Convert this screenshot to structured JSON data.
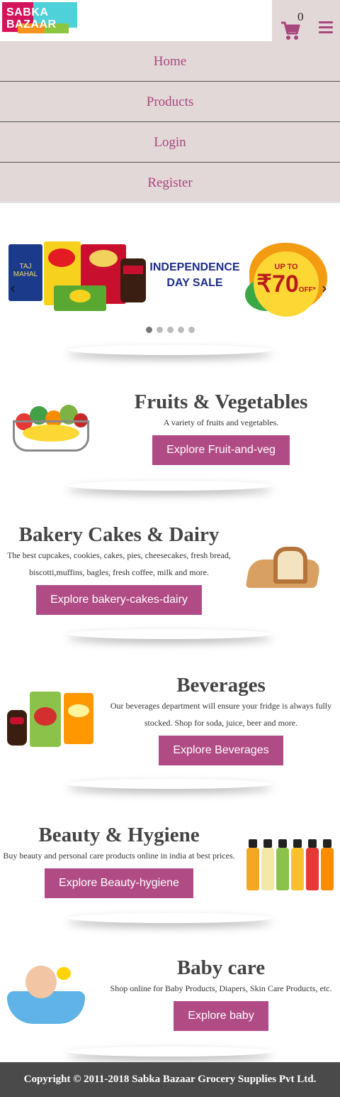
{
  "header": {
    "logo_line1": "SABKA",
    "logo_line2": "BAZAAR",
    "cart_count": "0"
  },
  "nav": {
    "items": [
      "Home",
      "Products",
      "Login",
      "Register"
    ]
  },
  "banner": {
    "product_taj": "TAJ MAHAL",
    "title_line1": "INDEPENDENCE",
    "title_line2": "DAY SALE",
    "offer_upto": "UP TO",
    "offer_value": "₹70",
    "offer_suffix": "OFF*",
    "prev_arrow": "‹",
    "next_arrow": "›",
    "dot_count": 5,
    "active_dot": 1
  },
  "categories": [
    {
      "title": "Fruits & Vegetables",
      "description": "A variety of fruits and vegetables.",
      "button": "Explore Fruit-and-veg"
    },
    {
      "title": "Bakery Cakes & Dairy",
      "description": "The best cupcakes, cookies, cakes, pies, cheesecakes, fresh bread, biscotti,muffins, bagles, fresh coffee, milk and more.",
      "button": "Explore bakery-cakes-dairy"
    },
    {
      "title": "Beverages",
      "description": "Our beverages department will ensure your fridge is always fully stocked. Shop for soda, juice, beer and more.",
      "button": "Explore Beverages"
    },
    {
      "title": "Beauty & Hygiene",
      "description": "Buy beauty and personal care products online in india at best prices.",
      "button": "Explore Beauty-hygiene"
    },
    {
      "title": "Baby care",
      "description": "Shop online for Baby Products, Diapers, Skin Care Products, etc.",
      "button": "Explore baby"
    }
  ],
  "footer": {
    "copyright": "Copyright © 2011-2018 Sabka Bazaar Grocery Supplies Pvt Ltd."
  },
  "colors": {
    "accent": "#b04b86",
    "nav_bg": "#e3d8d8",
    "footer_bg": "#4a4a4a"
  }
}
